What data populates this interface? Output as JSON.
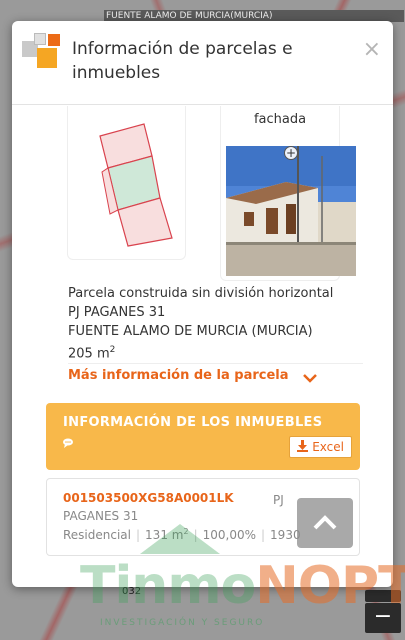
{
  "map": {
    "street_label": "FUENTE ALAMO DE MURCIA(MURCIA)",
    "parcel_label": "032",
    "zoom_out_label": "−"
  },
  "modal": {
    "title": "Información de parcelas e inmuebles",
    "close_label": "×"
  },
  "facade": {
    "caption": "fachada",
    "zoom_label": "+"
  },
  "parcel": {
    "line1": "Parcela construida sin división horizontal",
    "line2": "PJ PAGANES 31",
    "line3": "FUENTE ALAMO DE MURCIA (MURCIA)",
    "area_value": "205 m",
    "area_sup": "2",
    "more_link": "Más información de la parcela"
  },
  "inmuebles": {
    "title": "INFORMACIÓN DE LOS INMUEBLES",
    "excel_label": "Excel",
    "items": [
      {
        "ref": "001503500XG58A0001LK",
        "addr_part1": "PJ",
        "addr_part2": "PAGANES 31",
        "use": "Residencial",
        "surface": "131 m",
        "surface_sup": "2",
        "participation": "100,00%",
        "year": "1930"
      }
    ]
  },
  "watermark": {
    "brand_a": "Tinmo",
    "brand_b": "NOPT",
    "tagline": "INVESTIGACIÓN Y SEGURO"
  },
  "colors": {
    "accent": "#e8651a",
    "banner": "#f8b84a"
  }
}
